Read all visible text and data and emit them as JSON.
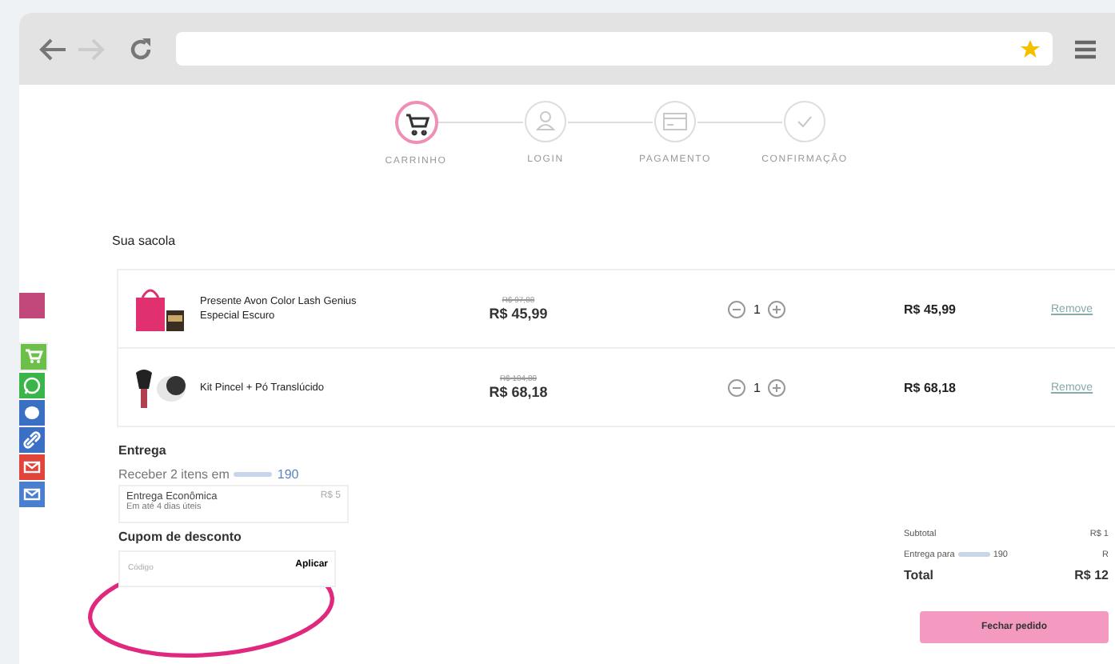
{
  "browser": {
    "bookmarked": true
  },
  "steps": [
    {
      "label": "CARRINHO",
      "selected": true
    },
    {
      "label": "LOGIN",
      "selected": false
    },
    {
      "label": "PAGAMENTO",
      "selected": false
    },
    {
      "label": "CONFIRMAÇÃO",
      "selected": false
    }
  ],
  "share_bar": [
    {
      "kind": "photo",
      "color": "#c2477a"
    },
    {
      "kind": "cart",
      "color": "#6cc04a"
    },
    {
      "kind": "whatsapp",
      "color": "#3bb54a"
    },
    {
      "kind": "messenger",
      "color": "#3b6fc4"
    },
    {
      "kind": "link",
      "color": "#3b6fc4"
    },
    {
      "kind": "mail",
      "color": "#e0443a"
    },
    {
      "kind": "mail",
      "color": "#4a7fd0"
    }
  ],
  "bag": {
    "title": "Sua sacola",
    "items": [
      {
        "name": "Presente Avon Color Lash Genius Especial Escuro",
        "old_price": "R$ 97,88",
        "price": "R$ 45,99",
        "quantity": "1",
        "total": "R$ 45,99",
        "remove": "Remove"
      },
      {
        "name": "Kit Pincel + Pó Translúcido",
        "old_price": "R$ 104,80",
        "price": "R$ 68,18",
        "quantity": "1",
        "total": "R$ 68,18",
        "remove": "Remove"
      }
    ]
  },
  "delivery": {
    "title": "Entrega",
    "receive": "Receber 2 itens em",
    "zip": "190",
    "option": {
      "name": "Entrega Econômica",
      "eta": "Em até 4 dias úteis",
      "price": "R$ 5"
    }
  },
  "coupon": {
    "title": "Cupom de desconto",
    "placeholder": "Código",
    "button": "Aplicar"
  },
  "summary": {
    "rows": [
      {
        "kind": "subtotal",
        "label": "Subtotal",
        "value": "R$ 1"
      },
      {
        "kind": "shipping",
        "label": "Entrega para",
        "zip": "190",
        "value": "R"
      },
      {
        "kind": "total",
        "label": "Total",
        "value": "R$ 12"
      }
    ],
    "button": "Fechar pedido"
  }
}
